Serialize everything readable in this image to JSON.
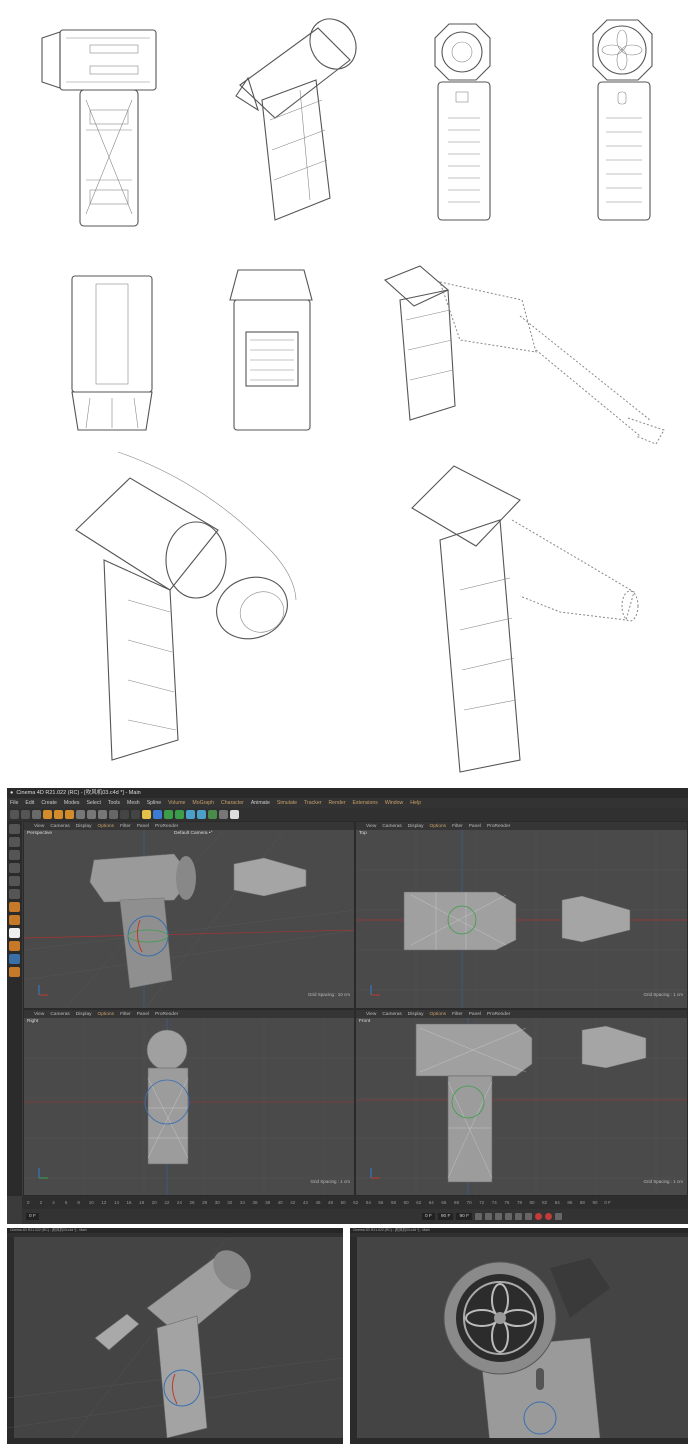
{
  "c4d": {
    "title": "Cinema 4D R21.022 (RC) - [吹风机03.c4d *] - Main",
    "menu": [
      "File",
      "Edit",
      "Create",
      "Modes",
      "Select",
      "Tools",
      "Mesh",
      "Spline",
      "Volume",
      "MoGraph",
      "Character",
      "Animate",
      "Simulate",
      "Tracker",
      "Render",
      "Extensions",
      "Window",
      "Help"
    ],
    "viewport_menu": [
      "View",
      "Cameras",
      "Display",
      "Options",
      "Filter",
      "Panel",
      "ProRender"
    ],
    "viewports": [
      {
        "name": "Perspective",
        "camera": "Default Camera •°",
        "grid": "Grid Spacing : 10 cm"
      },
      {
        "name": "Top",
        "camera": "",
        "grid": "Grid Spacing : 1 cm"
      },
      {
        "name": "Right",
        "camera": "",
        "grid": "Grid Spacing : 1 cm"
      },
      {
        "name": "Front",
        "camera": "",
        "grid": "Grid Spacing : 1 cm"
      }
    ],
    "timeline_ticks": [
      "0",
      "2",
      "4",
      "6",
      "8",
      "10",
      "12",
      "14",
      "16",
      "18",
      "20",
      "22",
      "24",
      "26",
      "28",
      "30",
      "32",
      "34",
      "36",
      "38",
      "40",
      "42",
      "44",
      "46",
      "48",
      "50",
      "52",
      "54",
      "56",
      "58",
      "60",
      "62",
      "64",
      "66",
      "68",
      "70",
      "72",
      "74",
      "76",
      "78",
      "80",
      "82",
      "84",
      "86",
      "88",
      "90",
      "0 F"
    ],
    "frame_fields": [
      "0 F",
      "0 F",
      "90 F",
      "90 F"
    ]
  },
  "mini_left_title": "Cinema 4D R21.022 (RC) - [吹风机03.c4d *] - Main",
  "mini_right_title": "Cinema 4D R21.022 (RC) - [吹风机03.c4d *] - Main",
  "colors": {
    "ui_bg": "#3b3b3b",
    "viewport": "#4a4a4a",
    "accent": "#c7a06a",
    "axis_x": "#c0392b",
    "axis_y": "#2f7fd1"
  }
}
